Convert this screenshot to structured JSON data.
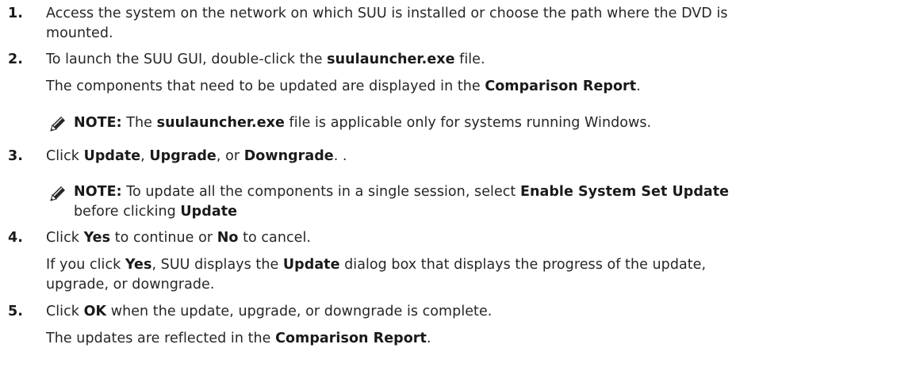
{
  "steps": [
    {
      "number": "1.",
      "line1": "Access the system on the network on which SUU is installed or choose the path where the DVD is",
      "line2": "mounted."
    },
    {
      "number": "2.",
      "text_pre": "To launch the SUU GUI, double-click the ",
      "file": "suulauncher.exe",
      "text_post": " file.",
      "detail_pre": "The components that need to be updated are displayed in the ",
      "detail_bold": "Comparison Report",
      "detail_post": ".",
      "note": {
        "label": "NOTE:",
        "pre": " The ",
        "bold": "suulauncher.exe",
        "post": " file is applicable only for systems running Windows."
      }
    },
    {
      "number": "3.",
      "text_pre": "Click ",
      "b1": "Update",
      "sep1": ", ",
      "b2": "Upgrade",
      "sep2": ", or ",
      "b3": "Downgrade",
      "text_post": ". .",
      "note": {
        "label": "NOTE:",
        "pre": " To update all the components in a single session, select ",
        "bold1": "Enable System Set Update",
        "line2_pre": "before clicking ",
        "bold2": "Update"
      }
    },
    {
      "number": "4.",
      "text_pre": "Click ",
      "b1": "Yes",
      "mid": " to continue or ",
      "b2": "No",
      "text_post": " to cancel.",
      "detail_pre": "If you click ",
      "detail_b1": "Yes",
      "detail_mid": ", SUU displays the ",
      "detail_b2": "Update",
      "detail_post": " dialog box that displays the progress of the update,",
      "detail_line2": "upgrade, or downgrade."
    },
    {
      "number": "5.",
      "text_pre": "Click ",
      "b1": "OK",
      "text_post": " when the update, upgrade, or downgrade is complete.",
      "detail_pre": "The updates are reflected in the ",
      "detail_bold": "Comparison Report",
      "detail_post": "."
    }
  ],
  "icons": {
    "note": "pencil-note-icon"
  }
}
